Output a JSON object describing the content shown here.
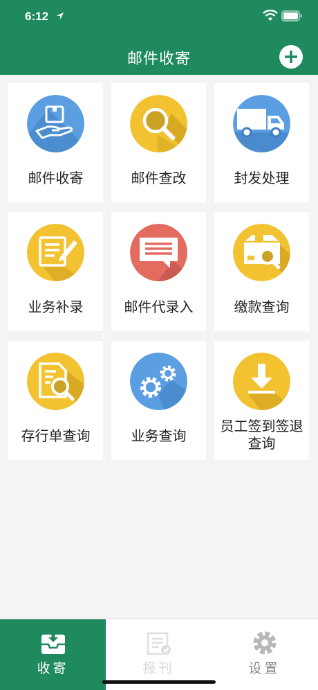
{
  "status": {
    "time": "6:12"
  },
  "nav": {
    "title": "邮件收寄"
  },
  "tiles": [
    {
      "label": "邮件收寄",
      "icon": "hand-package-icon",
      "color": "#5b9ee1"
    },
    {
      "label": "邮件查改",
      "icon": "magnifier-icon",
      "color": "#f2c230"
    },
    {
      "label": "封发处理",
      "icon": "truck-icon",
      "color": "#5b9ee1"
    },
    {
      "label": "业务补录",
      "icon": "notepad-pen-icon",
      "color": "#f2c230"
    },
    {
      "label": "邮件代录入",
      "icon": "message-icon",
      "color": "#e36b60"
    },
    {
      "label": "缴款查询",
      "icon": "box-search-icon",
      "color": "#f2c230"
    },
    {
      "label": "存行单查询",
      "icon": "document-search-icon",
      "color": "#f2c230"
    },
    {
      "label": "业务查询",
      "icon": "gears-icon",
      "color": "#5b9ee1"
    },
    {
      "label": "员工签到签退查询",
      "icon": "download-icon",
      "color": "#f2c230"
    }
  ],
  "tabs": [
    {
      "label": "收寄",
      "icon": "inbox-icon"
    },
    {
      "label": "报刊",
      "icon": "newspaper-icon"
    },
    {
      "label": "设置",
      "icon": "gear-icon"
    }
  ],
  "colors": {
    "brand": "#1e8a5e",
    "blue": "#5b9ee1",
    "yellow": "#f2c230",
    "red": "#e36b60"
  }
}
